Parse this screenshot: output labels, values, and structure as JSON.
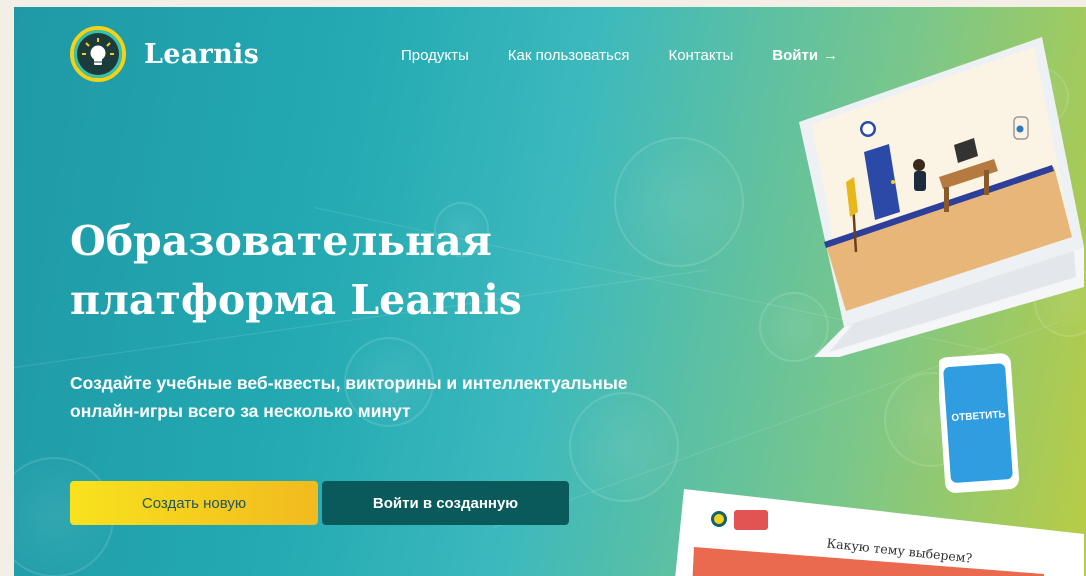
{
  "brand": {
    "name": "Learnis"
  },
  "nav": {
    "items": [
      "Продукты",
      "Как пользоваться",
      "Контакты"
    ],
    "login_label": "Войти",
    "login_arrow": "→"
  },
  "hero": {
    "headline_line1": "Образовательная",
    "headline_line2": "платформа Learnis",
    "subtitle_line1": "Создайте учебные веб-квесты, викторины и интеллектуальные",
    "subtitle_line2": "онлайн-игры всего за несколько минут",
    "create_button": "Создать новую",
    "enter_button": "Войти в созданную"
  },
  "devices": {
    "phone_label": "ОТВЕТИТЬ",
    "tablet_question": "Какую тему выберем?"
  },
  "colors": {
    "accent_yellow": "#f8e21d",
    "dark_teal": "#0a5a5b",
    "hero_teal": "#23aab2",
    "hero_green": "#b9cc44"
  }
}
